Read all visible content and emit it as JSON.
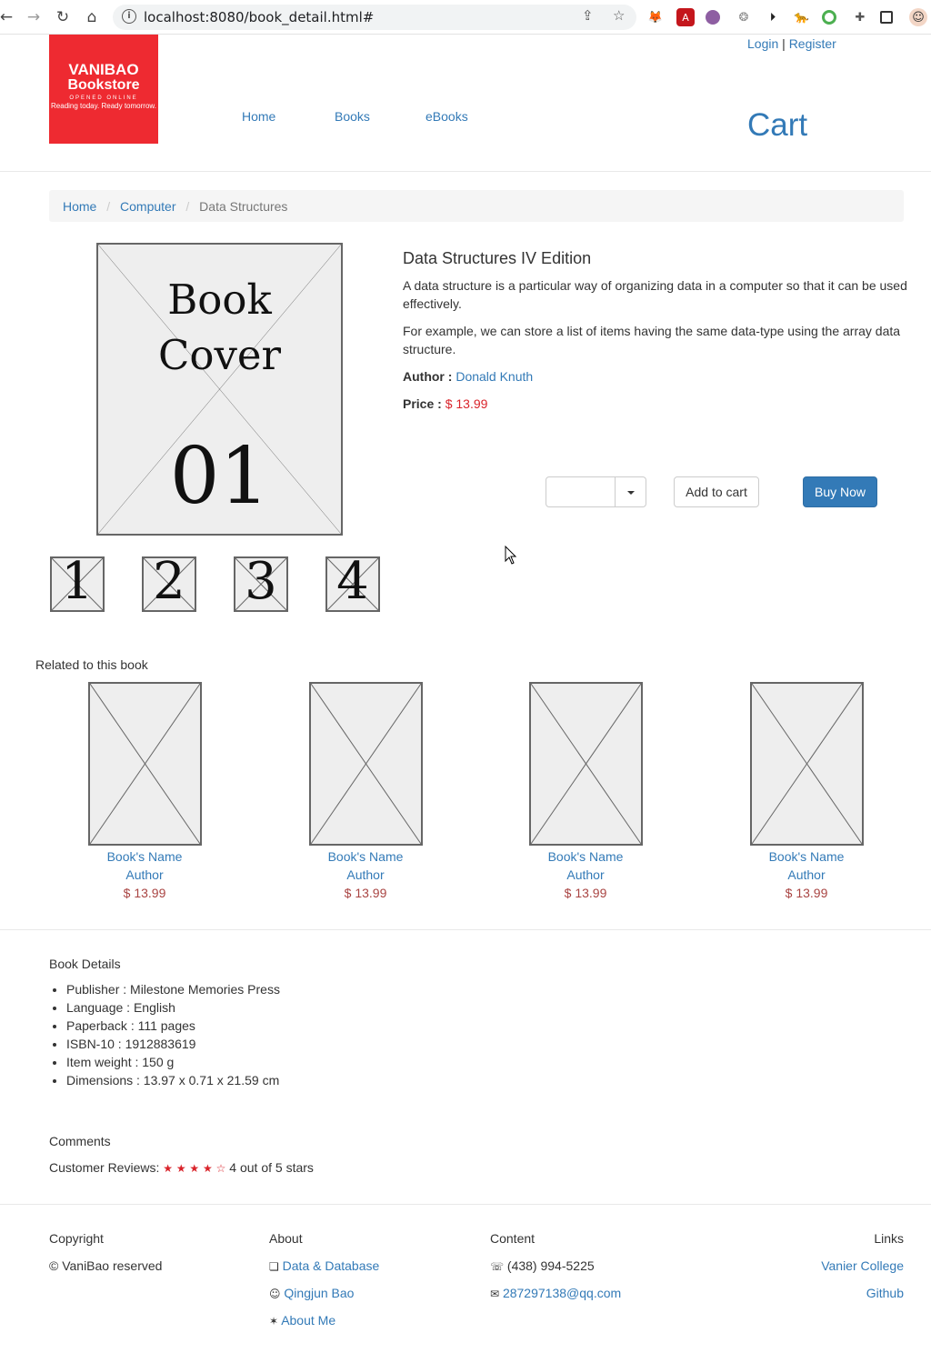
{
  "browser": {
    "url": "localhost:8080/book_detail.html#"
  },
  "header": {
    "logo": {
      "line1": "VANIBAO",
      "line2": "Bookstore",
      "line3": "OPENED ONLINE",
      "line4": "Reading today. Ready tomorrow."
    },
    "login": "Login",
    "separator": "|",
    "register": "Register",
    "nav": [
      "Home",
      "Books",
      "eBooks"
    ],
    "cart": "Cart"
  },
  "breadcrumb": {
    "items": [
      "Home",
      "Computer"
    ],
    "active": "Data Structures",
    "separator": "/"
  },
  "product": {
    "cover": {
      "line1": "Book",
      "line2": "Cover",
      "number": "01"
    },
    "thumbs": [
      "1",
      "2",
      "3",
      "4"
    ],
    "title": "Data Structures IV Edition",
    "desc1": "A data structure is a particular way of organizing data in a computer so that it can be used effectively.",
    "desc2": "For example, we can store a list of items having the same data-type using the array data structure.",
    "author_label": "Author :",
    "author": "Donald Knuth",
    "price_label": "Price :",
    "price": "$ 13.99",
    "add_to_cart": "Add to cart",
    "buy_now": "Buy Now"
  },
  "related": {
    "heading": "Related to this book",
    "items": [
      {
        "name": "Book's Name",
        "author": "Author",
        "price": "$ 13.99"
      },
      {
        "name": "Book's Name",
        "author": "Author",
        "price": "$ 13.99"
      },
      {
        "name": "Book's Name",
        "author": "Author",
        "price": "$ 13.99"
      },
      {
        "name": "Book's Name",
        "author": "Author",
        "price": "$ 13.99"
      }
    ]
  },
  "details": {
    "heading": "Book Details",
    "items": [
      "Publisher : Milestone Memories Press",
      "Language : English",
      "Paperback : 111 pages",
      "ISBN-10 : 1912883619",
      "Item weight : 150 g",
      "Dimensions : 13.97 x 0.71 x 21.59 cm"
    ]
  },
  "comments": {
    "heading": "Comments",
    "label": "Customer Reviews:",
    "stars_filled": "★ ★ ★ ★",
    "stars_empty": "☆",
    "rating_text": "4 out of 5 stars",
    "rating": 4,
    "max_rating": 5
  },
  "footer": {
    "copyright": {
      "heading": "Copyright",
      "text": "© VaniBao reserved"
    },
    "about": {
      "heading": "About",
      "links": [
        {
          "glyph": "❏",
          "text": "Data & Database"
        },
        {
          "glyph": "☺",
          "text": "Qingjun Bao"
        },
        {
          "glyph": "✶",
          "text": "About Me"
        }
      ]
    },
    "content": {
      "heading": "Content",
      "phone_glyph": "☏",
      "phone": "(438) 994-5225",
      "email_glyph": "✉",
      "email": "287297138@qq.com"
    },
    "links": {
      "heading": "Links",
      "items": [
        "Vanier College",
        "Github"
      ]
    }
  },
  "colors": {
    "brand_red": "#ee2a31",
    "link": "#337ab7",
    "price_red": "#d9232a",
    "primary_button": "#337ab7"
  }
}
